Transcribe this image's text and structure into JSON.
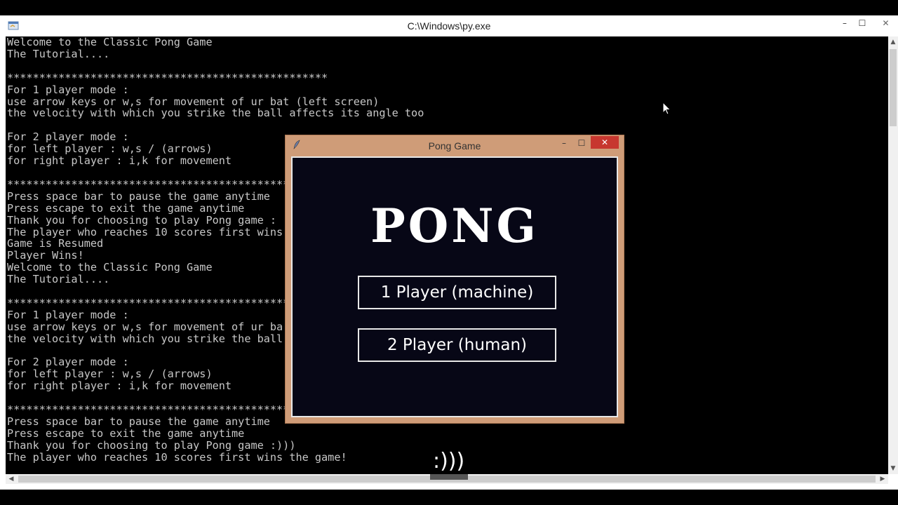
{
  "console": {
    "title": "C:\\Windows\\py.exe",
    "lines": [
      "Welcome to the Classic Pong Game",
      "The Tutorial....",
      "",
      "**************************************************",
      "For 1 player mode :",
      "use arrow keys or w,s for movement of ur bat (left screen)",
      "the velocity with which you strike the ball affects its angle too",
      "",
      "For 2 player mode :",
      "for left player : w,s / (arrows)",
      "for right player : i,k for movement",
      "",
      "**************************************************",
      "Press space bar to pause the game anytime",
      "Press escape to exit the game anytime",
      "Thank you for choosing to play Pong game :",
      "The player who reaches 10 scores first wins",
      "Game is Resumed",
      "Player Wins!",
      "Welcome to the Classic Pong Game",
      "The Tutorial....",
      "",
      "**************************************************",
      "For 1 player mode :",
      "use arrow keys or w,s for movement of ur ba",
      "the velocity with which you strike the ball",
      "",
      "For 2 player mode :",
      "for left player : w,s / (arrows)",
      "for right player : i,k for movement",
      "",
      "**************************************************",
      "Press space bar to pause the game anytime",
      "Press escape to exit the game anytime",
      "Thank you for choosing to play Pong game :)))",
      "The player who reaches 10 scores first wins the game!"
    ],
    "controls": {
      "minimize": "–",
      "maximize": "☐",
      "close": "✕"
    }
  },
  "pong": {
    "title": "Pong Game",
    "logo": "PONG",
    "buttons": {
      "one_player": "1 Player (machine)",
      "two_player": "2 Player (human)"
    },
    "controls": {
      "minimize": "–",
      "maximize": "☐",
      "close": "✕"
    }
  },
  "caption": ":)))",
  "icons": {
    "console_app": "python-console-icon",
    "pong_app": "feather-icon",
    "cursor": "mouse-pointer-icon"
  }
}
